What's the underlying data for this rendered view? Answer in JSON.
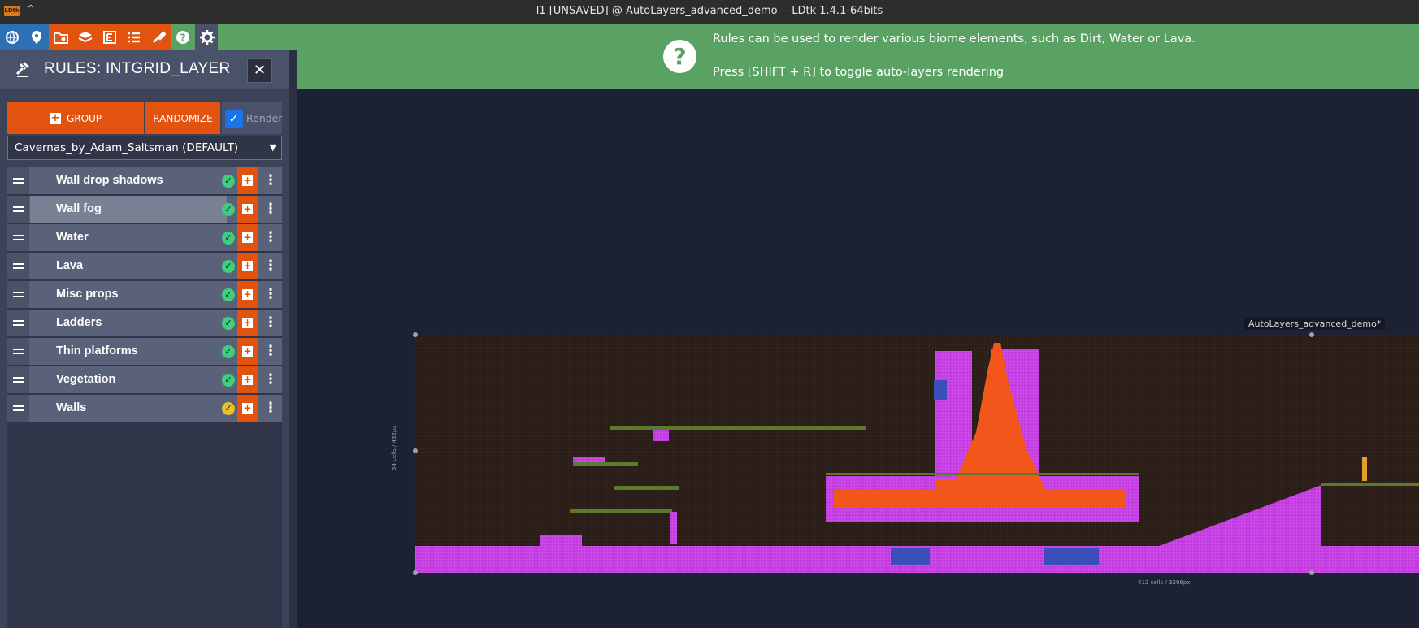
{
  "titlebar": {
    "logo": "LDtk",
    "title": "l1 [UNSAVED] @ AutoLayers_advanced_demo -- LDtk 1.4.1-64bits"
  },
  "toolbar": {
    "buttons": [
      {
        "name": "world-icon",
        "color": "#2f6fb3"
      },
      {
        "name": "location-icon",
        "color": "#2f6fb3"
      },
      {
        "name": "level-settings-icon",
        "color": "#e2530f"
      },
      {
        "name": "layers-icon",
        "color": "#e2530f"
      },
      {
        "name": "entities-icon",
        "color": "#e2530f"
      },
      {
        "name": "enums-icon",
        "color": "#e2530f"
      },
      {
        "name": "tilesets-icon",
        "color": "#e2530f"
      },
      {
        "name": "help-icon",
        "color": "#5aa263"
      },
      {
        "name": "settings-icon",
        "color": "#4a526a"
      },
      {
        "name": "exit-icon",
        "color": "#2d2d2d"
      }
    ]
  },
  "banner": {
    "line1": "Rules can be used to render various biome elements, such as Dirt, Water or Lava.",
    "line2": "Press [SHIFT + R] to toggle auto-layers rendering"
  },
  "panel": {
    "title": "RULES: INTGRID_LAYER",
    "group_label": "GROUP",
    "randomize_label": "RANDOMIZE",
    "render_label": "Render",
    "render_checked": true,
    "preset": "Cavernas_by_Adam_Saltsman (DEFAULT)",
    "rules": [
      {
        "label": "Wall drop shadows",
        "status": "ok",
        "selected": false
      },
      {
        "label": "Wall fog",
        "status": "ok",
        "selected": true
      },
      {
        "label": "Water",
        "status": "ok",
        "selected": false
      },
      {
        "label": "Lava",
        "status": "ok",
        "selected": false
      },
      {
        "label": "Misc props",
        "status": "ok",
        "selected": false
      },
      {
        "label": "Ladders",
        "status": "ok",
        "selected": false
      },
      {
        "label": "Thin platforms",
        "status": "ok",
        "selected": false
      },
      {
        "label": "Vegetation",
        "status": "ok",
        "selected": false
      },
      {
        "label": "Walls",
        "status": "warning",
        "selected": false
      }
    ],
    "status_colors": {
      "ok": "#3fce7c",
      "warning": "#e6c229"
    }
  },
  "canvas": {
    "level_name": "AutoLayers_advanced_demo*",
    "width_label": "412 cells / 3296px",
    "height_label": "54 cells / 432px",
    "colors": {
      "wall": "#c23be0",
      "lava": "#f2561a",
      "water": "#3b4fb8",
      "grass": "#5c7a2c",
      "dirt": "#2a1d18"
    }
  }
}
